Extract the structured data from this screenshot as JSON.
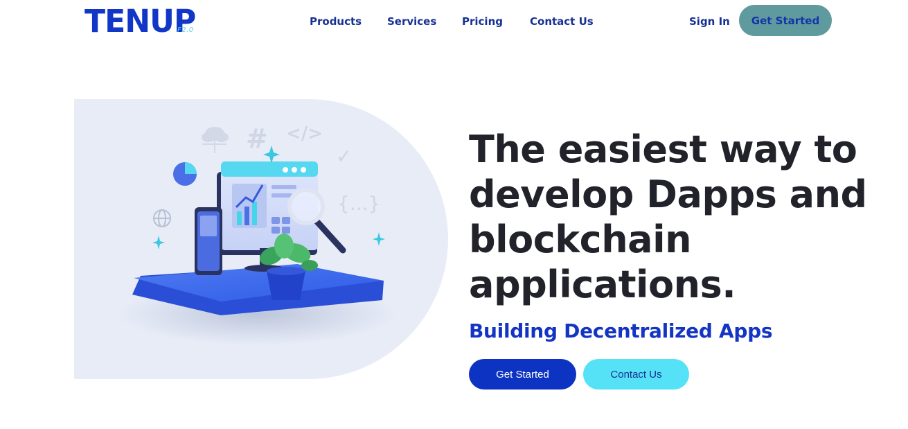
{
  "brand": {
    "logo_text": "TENUP",
    "logo_subtext": "F2.0",
    "accent": "#1237c6"
  },
  "nav": {
    "items": [
      {
        "label": "Products"
      },
      {
        "label": "Services"
      },
      {
        "label": "Pricing"
      },
      {
        "label": "Contact Us"
      }
    ],
    "sign_in": "Sign In",
    "get_started": "Get Started"
  },
  "hero": {
    "headline": "The easiest way to develop Dapps and blockchain applications.",
    "subheadline": "Building Decentralized Apps",
    "primary_button": "Get Started",
    "secondary_button": "Contact Us",
    "illustration_icons": [
      "cloud-network-icon",
      "hash-icon",
      "code-tag-icon",
      "checkmark-icon",
      "pie-chart-icon",
      "braces-icon",
      "globe-icon",
      "sparkle-icon",
      "monitor-icon",
      "smartphone-icon",
      "magnifier-icon",
      "plant-icon"
    ]
  },
  "colors": {
    "primary": "#0d33c2",
    "secondary": "#55e2f6",
    "header_button": "#5f9b9e",
    "hero_bg": "#e7ecf7",
    "text_dark": "#22232a"
  }
}
